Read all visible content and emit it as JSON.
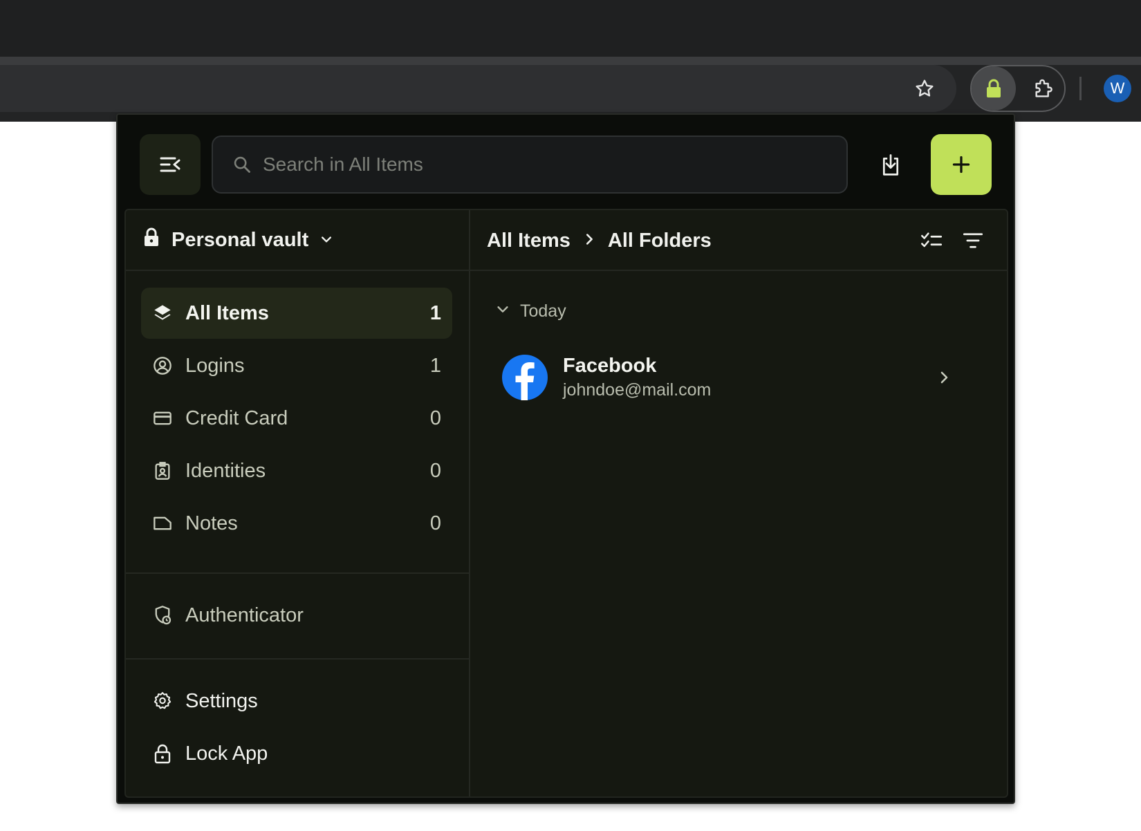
{
  "browser": {
    "profile_initial": "W"
  },
  "header": {
    "search_placeholder": "Search in All Items"
  },
  "sidebar": {
    "vault_name": "Personal vault",
    "items": [
      {
        "label": "All Items",
        "count": "1",
        "icon": "layers-icon"
      },
      {
        "label": "Logins",
        "count": "1",
        "icon": "user-circle-icon"
      },
      {
        "label": "Credit Card",
        "count": "0",
        "icon": "credit-card-icon"
      },
      {
        "label": "Identities",
        "count": "0",
        "icon": "id-badge-icon"
      },
      {
        "label": "Notes",
        "count": "0",
        "icon": "note-icon"
      }
    ],
    "authenticator_label": "Authenticator",
    "settings_label": "Settings",
    "lock_label": "Lock App"
  },
  "main": {
    "breadcrumb": [
      "All Items",
      "All Folders"
    ],
    "group_label": "Today",
    "items": [
      {
        "title": "Facebook",
        "subtitle": "johndoe@mail.com"
      }
    ]
  },
  "colors": {
    "accent": "#c0e059",
    "facebook": "#1877f2",
    "popup_bg": "#0b0d0a",
    "panel_bg": "#151811"
  }
}
